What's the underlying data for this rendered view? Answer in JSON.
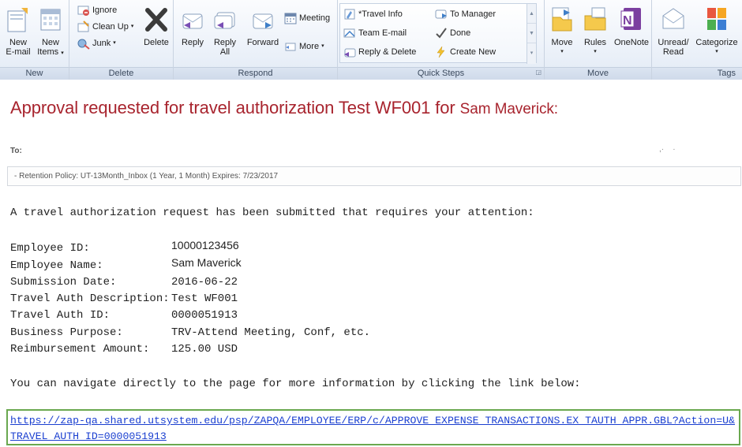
{
  "ribbon": {
    "new_group": {
      "label": "New",
      "new_email": "New\nE-mail",
      "new_items": "New\nItems"
    },
    "delete_group": {
      "label": "Delete",
      "ignore": "Ignore",
      "clean_up": "Clean Up",
      "junk": "Junk",
      "delete": "Delete"
    },
    "respond_group": {
      "label": "Respond",
      "reply": "Reply",
      "reply_all": "Reply\nAll",
      "forward": "Forward",
      "meeting": "Meeting",
      "more": "More"
    },
    "quick_steps_group": {
      "label": "Quick Steps",
      "items": [
        "*Travel Info",
        "To Manager",
        "Team E-mail",
        "Done",
        "Reply & Delete",
        "Create New"
      ]
    },
    "move_group": {
      "label": "Move",
      "move": "Move",
      "rules": "Rules",
      "onenote": "OneNote"
    },
    "tags_group": {
      "label": "Tags",
      "unread_read": "Unread/\nRead",
      "categorize": "Categorize"
    }
  },
  "message": {
    "subject_main": "Approval requested for travel authorization Test WF001 for ",
    "subject_name": "Sam Maverick:",
    "to_label": "To:",
    "retention": "- Retention Policy: UT-13Month_Inbox (1 Year, 1 Month) Expires: 7/23/2017",
    "intro": "A travel authorization request has been submitted that requires your attention:",
    "fields": [
      {
        "label": "Employee ID:",
        "value": "10000123456"
      },
      {
        "label": "Employee Name:",
        "value": "Sam Maverick"
      },
      {
        "label": "Submission Date:",
        "value": "2016-06-22"
      },
      {
        "label": "Travel Auth Description:",
        "value": "Test WF001"
      },
      {
        "label": "Travel Auth ID:",
        "value": "0000051913"
      },
      {
        "label": "Business Purpose:",
        "value": "TRV-Attend Meeting, Conf, etc."
      },
      {
        "label": "Reimbursement Amount:",
        "value": "125.00 USD"
      }
    ],
    "nav_text": "You can navigate directly to the page for more information by clicking the link below:",
    "link": "https://zap-qa.shared.utsystem.edu/psp/ZAPQA/EMPLOYEE/ERP/c/APPROVE_EXPENSE_TRANSACTIONS.EX_TAUTH_APPR.GBL?Action=U&TRAVEL_AUTH_ID=0000051913"
  },
  "colors": {
    "subject": "#a8242e",
    "link": "#1a3fd0",
    "link_border": "#6aa84f"
  }
}
